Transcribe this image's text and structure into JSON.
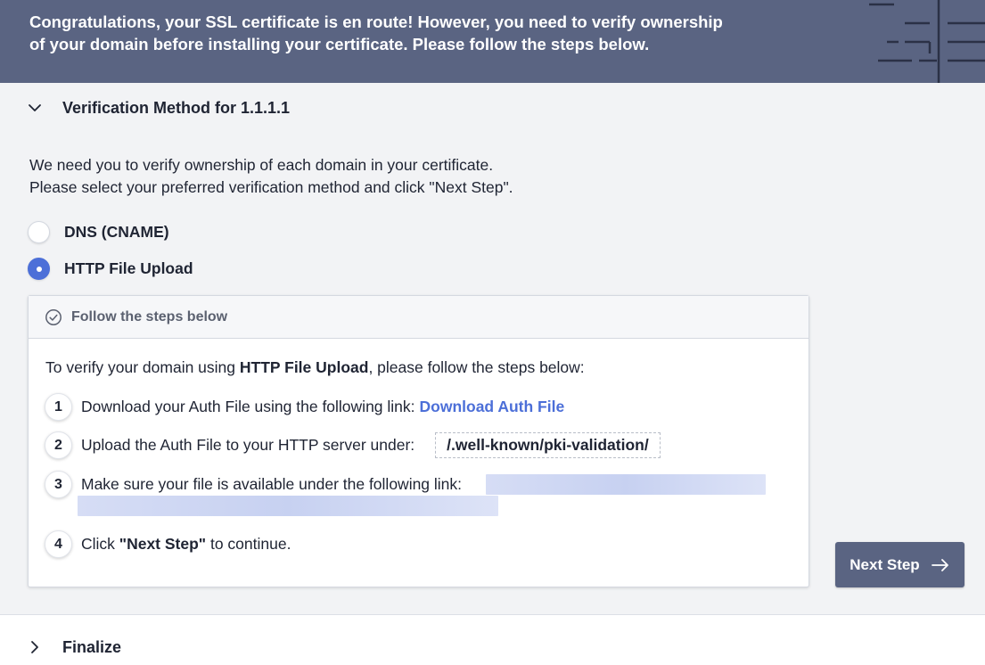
{
  "banner": {
    "line1": "Congratulations, your SSL certificate is en route! However, you need to verify ownership",
    "line2": "of your domain before installing your certificate. Please follow the steps below."
  },
  "verification": {
    "section_title": "Verification Method for 1.1.1.1",
    "intro_line1": "We need you to verify ownership of each domain in your certificate.",
    "intro_line2": "Please select your preferred verification method and click \"Next Step\".",
    "options": [
      {
        "label": "DNS (CNAME)",
        "selected": false
      },
      {
        "label": "HTTP File Upload",
        "selected": true
      }
    ]
  },
  "steps_card": {
    "title": "Follow the steps below",
    "lead_prefix": "To verify your domain using ",
    "lead_bold": "HTTP File Upload",
    "lead_suffix": ", please follow the steps below:",
    "steps": [
      {
        "num": "1",
        "text": "Download your Auth File using the following link:",
        "link": "Download Auth File"
      },
      {
        "num": "2",
        "text": "Upload the Auth File to your HTTP server under:",
        "path": "/.well-known/pki-validation/"
      },
      {
        "num": "3",
        "text": "Make sure your file is available under the following link:"
      },
      {
        "num": "4",
        "text_prefix": "Click ",
        "text_bold": "\"Next Step\"",
        "text_suffix": " to continue."
      }
    ]
  },
  "next_button": {
    "label": "Next Step"
  },
  "finalize": {
    "title": "Finalize"
  },
  "icons": {
    "expanded": "chevron-down-icon",
    "collapsed": "chevron-right-icon",
    "card": "check-circle-icon",
    "button": "arrow-right-icon"
  },
  "colors": {
    "banner": "#5a6482",
    "accent": "#4c6fd8",
    "button": "#5a6482"
  }
}
